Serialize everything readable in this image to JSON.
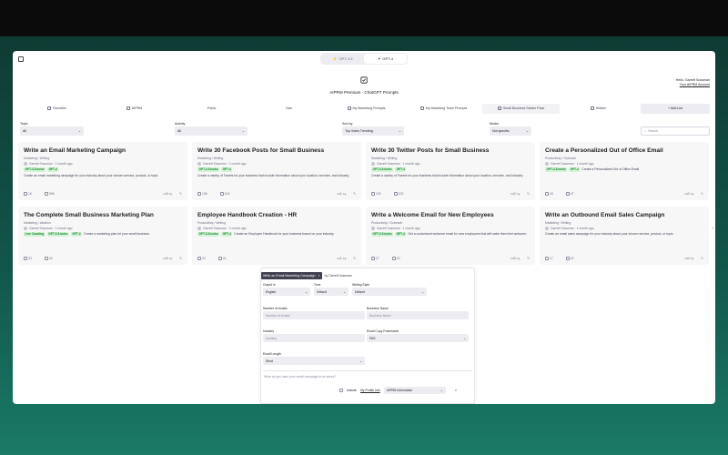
{
  "header": {
    "model_gpt35": "GPT-3.5",
    "model_gpt4": "GPT-4",
    "greeting": "Hello, Garrett Sussman",
    "account_link": "Your AIPRM Account",
    "title": "AIPRM Premium - ChatGPT Prompts"
  },
  "tabs": [
    {
      "label": "Favorites",
      "icon": "star-icon"
    },
    {
      "label": "AIPRM",
      "icon": "aiprm-icon"
    },
    {
      "label": "Public",
      "icon": "globe-icon"
    },
    {
      "label": "Own",
      "icon": "user-icon"
    },
    {
      "label": "My Marketing Prompts",
      "icon": "list-icon"
    },
    {
      "label": "My Marketing Team Prompts",
      "icon": "team-icon"
    },
    {
      "label": "Small Business Starter Pack",
      "icon": "pack-icon"
    },
    {
      "label": "Hidden",
      "icon": "eye-off-icon"
    }
  ],
  "add_list_label": "+ Add List",
  "filters": {
    "topic_label": "Topic",
    "topic_value": "All",
    "activity_label": "Activity",
    "activity_value": "All",
    "sort_label": "Sort by",
    "sort_value": "Top Votes Trending",
    "model_label": "Model",
    "model_value": "Not specific",
    "search_placeholder": "Search"
  },
  "cards": [
    {
      "title": "Write an Email Marketing Campaign",
      "category": "Marketing / Writing",
      "author": "Garrett Sussman · 1 month ago",
      "badges": [
        "GPT-3.5-turbo",
        "GPT-4"
      ],
      "desc": "Create an email marketing campaign for your industry about your chosen service, product, or topic.",
      "views": "1K",
      "uses": "996",
      "votes": "3"
    },
    {
      "title": "Write 30 Facebook Posts for Small Business",
      "category": "Marketing / Writing",
      "author": "Garrett Sussman · 1 month ago",
      "badges": [
        "GPT-3.5-turbo",
        "GPT-4"
      ],
      "desc": "Create a variety of Tweets for your business that include information about your location, services, and industry.",
      "views": "136",
      "uses": "163",
      "votes": "1"
    },
    {
      "title": "Write 30 Twitter Posts for Small Business",
      "category": "Marketing / Writing",
      "author": "Garrett Sussman · 1 month ago",
      "badges": [
        "GPT-3.5-turbo",
        "GPT-4"
      ],
      "desc": "Create a variety of Tweets for your business that include information about your location, services, and industry.",
      "views": "192",
      "uses": "123",
      "votes": "2"
    },
    {
      "title": "Create a Personalized Out of Office Email",
      "category": "Productivity / Outreach",
      "author": "Garrett Sussman · 1 month ago",
      "badges": [
        "GPT-3.5-turbo",
        "GPT-4"
      ],
      "desc": "Create a Personalized Out of Office Email",
      "views": "43",
      "uses": "47",
      "votes": "3"
    },
    {
      "title": "The Complete Small Business Marketing Plan",
      "category": "Marketing / Ideation",
      "author": "Garrett Sussman · 1 month ago",
      "badges": [
        "Live Crawling",
        "GPT-3.5-turbo",
        "GPT-4"
      ],
      "desc": "Create a marketing plan for your small business.",
      "views": "33",
      "uses": "43",
      "votes": "0"
    },
    {
      "title": "Employee Handbook Creation - HR",
      "category": "Productivity / Writing",
      "author": "Garrett Sussman · 1 month ago",
      "badges": [
        "GPT-3.5-turbo",
        "GPT-4"
      ],
      "desc": "Create an Employee Handbook for your business based on your industry.",
      "views": "22",
      "uses": "24",
      "votes": "1"
    },
    {
      "title": "Write a Welcome Email for New Employees",
      "category": "Productivity / Outreach",
      "author": "Garrett Sussman · 1 month ago",
      "badges": [
        "GPT-3.5-turbo",
        "GPT-4"
      ],
      "desc": "Get a customized welcome email for new employees that will make them feel welcome.",
      "views": "27",
      "uses": "20",
      "votes": "0"
    },
    {
      "title": "Write an Outbound Email Sales Campaign",
      "category": "Marketing / Writing",
      "author": "Garrett Sussman · 1 month ago",
      "badges": [],
      "desc": "Create an email sales campaign for your industry about your chosen service, product, or topic.",
      "views": "17",
      "uses": "29",
      "votes": "4"
    }
  ],
  "composer": {
    "chip_label": "Write an Email Marketing Campaign",
    "by": "by Garrett Sussman",
    "output_label": "Output in",
    "output_value": "English",
    "tone_label": "Tone",
    "tone_value": "Default",
    "style_label": "Writing Style",
    "style_value": "Default",
    "num_label": "Number of emails",
    "num_placeholder": "Number of emails",
    "biz_label": "Business Name",
    "biz_placeholder": "Business Name",
    "industry_label": "Industry",
    "industry_placeholder": "Industry",
    "framework_label": "Email Copy Framework",
    "framework_value": "PAS",
    "length_label": "Email Length",
    "length_value": "Short",
    "prompt_placeholder": "What do you want your email campaign to be about?",
    "include_text": "Include",
    "profile_link": "My Profile Info",
    "info_select": "AIPRM Information"
  }
}
